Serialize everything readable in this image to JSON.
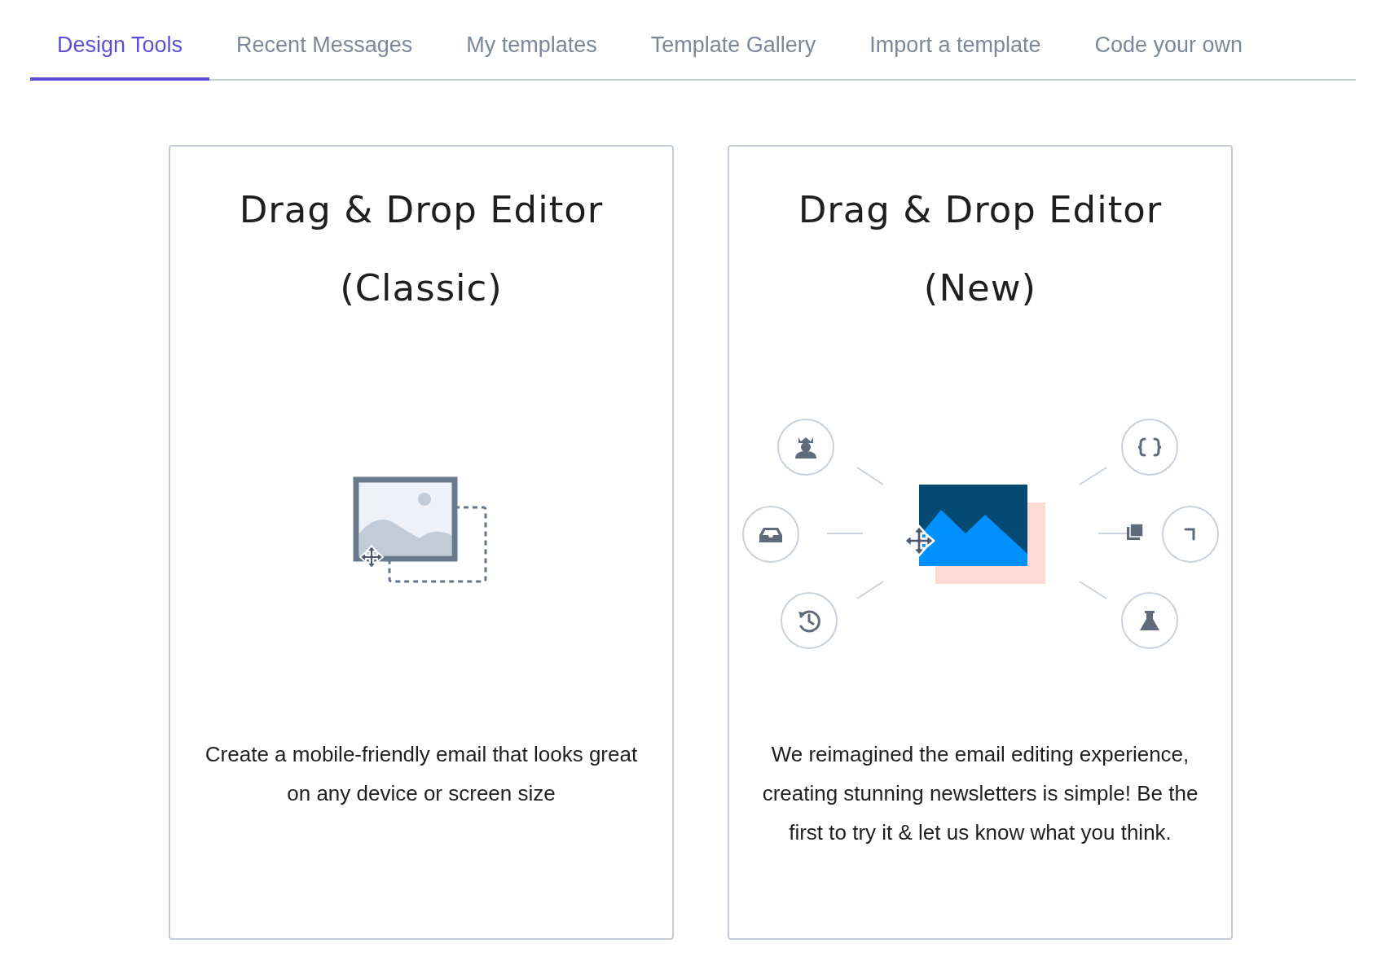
{
  "tabs": [
    {
      "label": "Design Tools",
      "selected": true
    },
    {
      "label": "Recent Messages",
      "selected": false
    },
    {
      "label": "My templates",
      "selected": false
    },
    {
      "label": "Template Gallery",
      "selected": false
    },
    {
      "label": "Import a template",
      "selected": false
    },
    {
      "label": "Code your own",
      "selected": false
    }
  ],
  "cards": [
    {
      "kind": "classic",
      "title": "Drag & Drop Editor (Classic)",
      "description": "Create a mobile-friendly email that looks great on any device or screen size"
    },
    {
      "kind": "new",
      "title": "Drag & Drop Editor (New)",
      "description": "We reimagined the email editing experience, creating stunning newsletters is simple! Be the first to try it & let us know what you think."
    }
  ]
}
